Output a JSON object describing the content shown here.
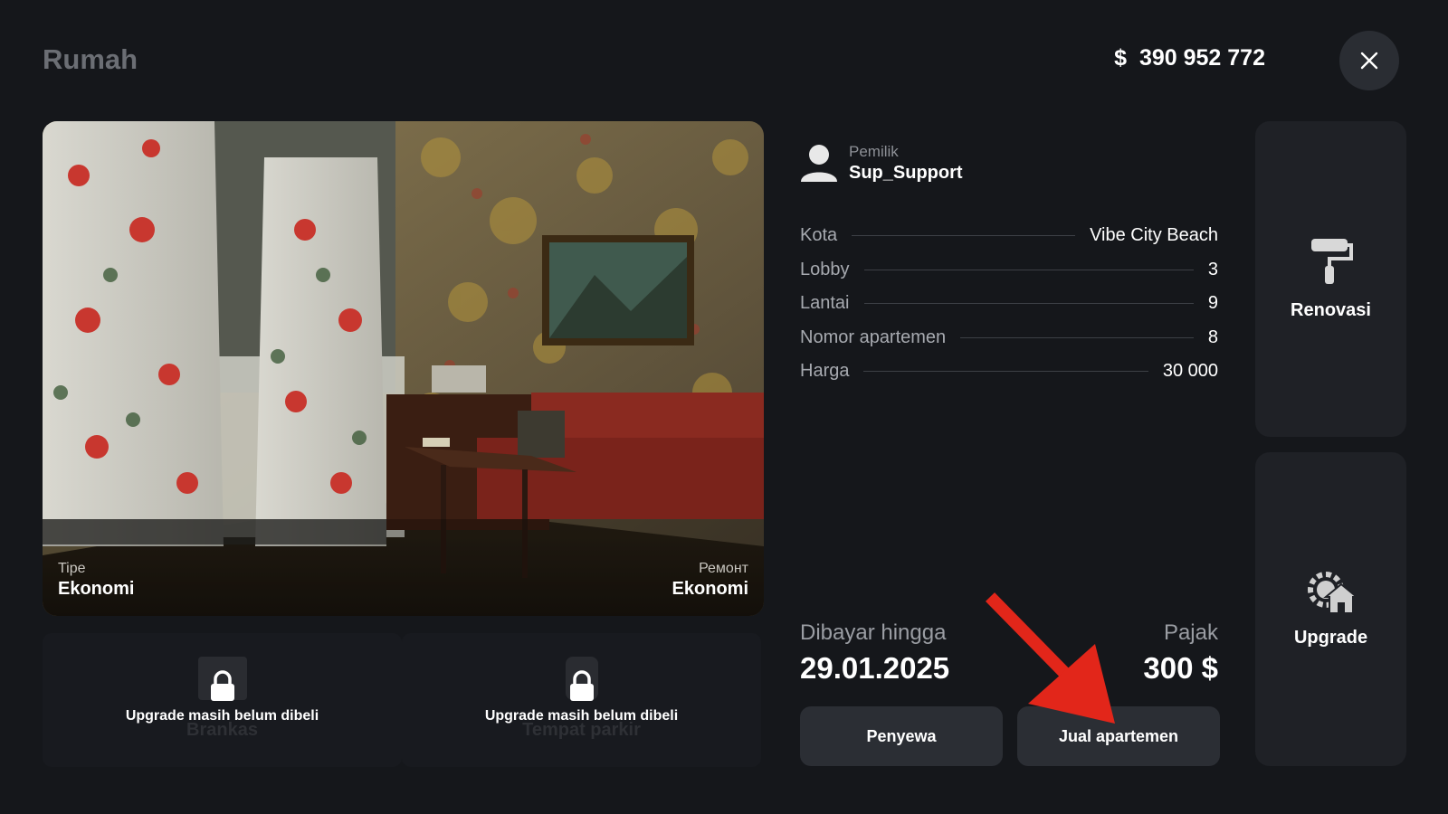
{
  "header": {
    "title": "Rumah",
    "currency_symbol": "$",
    "balance": "390 952 772"
  },
  "photo": {
    "type_label": "Tipe",
    "type_value": "Ekonomi",
    "repair_label": "Ремонт",
    "repair_value": "Ekonomi"
  },
  "slots": [
    {
      "message": "Upgrade masih belum dibeli",
      "label": "Brankas",
      "icon": "safe-icon"
    },
    {
      "message": "Upgrade masih belum dibeli",
      "label": "Tempat parkir",
      "icon": "parking-icon"
    }
  ],
  "owner": {
    "label": "Pemilik",
    "name": "Sup_Support"
  },
  "info": [
    {
      "key": "Kota",
      "value": "Vibe City Beach"
    },
    {
      "key": "Lobby",
      "value": "3"
    },
    {
      "key": "Lantai",
      "value": "9"
    },
    {
      "key": "Nomor apartemen",
      "value": "8"
    },
    {
      "key": "Harga",
      "value": "30 000"
    }
  ],
  "payment": {
    "paid_label": "Dibayar hingga",
    "paid_date": "29.01.2025",
    "tax_label": "Pajak",
    "tax_value": "300 $"
  },
  "buttons": {
    "tenant": "Penyewa",
    "sell": "Jual apartemen"
  },
  "side": {
    "renovate": "Renovasi",
    "upgrade": "Upgrade"
  },
  "colors": {
    "background": "#15171b",
    "card": "#1f2126",
    "button": "#2b2e34",
    "annotation_arrow": "#e2261a"
  }
}
